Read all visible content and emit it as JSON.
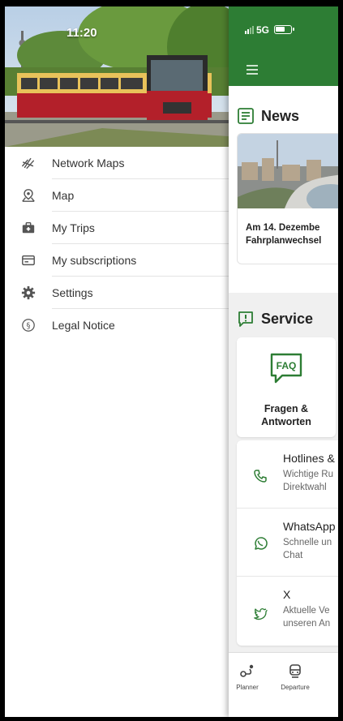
{
  "status": {
    "time": "11:20",
    "network": "5G"
  },
  "drawer": {
    "items": [
      {
        "label": "Network Maps",
        "icon": "network-map-icon"
      },
      {
        "label": "Map",
        "icon": "map-pin-icon"
      },
      {
        "label": "My Trips",
        "icon": "briefcase-icon"
      },
      {
        "label": "My subscriptions",
        "icon": "ticket-card-icon"
      },
      {
        "label": "Settings",
        "icon": "gear-icon"
      },
      {
        "label": "Legal Notice",
        "icon": "paragraph-icon"
      }
    ]
  },
  "news": {
    "title": "News",
    "card_line1": "Am 14. Dezembe",
    "card_line2": "Fahrplanwechsel"
  },
  "service": {
    "title": "Service",
    "faq_badge": "FAQ",
    "faq_line1": "Fragen &",
    "faq_line2": "Antworten",
    "contacts": [
      {
        "title": "Hotlines &",
        "line1": "Wichtige Ru",
        "line2": "Direktwahl",
        "icon": "phone-icon"
      },
      {
        "title": "WhatsApp",
        "line1": "Schnelle un",
        "line2": "Chat",
        "icon": "whatsapp-icon"
      },
      {
        "title": "X",
        "line1": "Aktuelle Ve",
        "line2": "unseren An",
        "icon": "bird-icon"
      }
    ]
  },
  "bottom_nav": {
    "planner": "Planner",
    "departures": "Departure"
  },
  "colors": {
    "brand_green": "#2d7d34",
    "train_red": "#b3202a",
    "train_yellow": "#e8c25a"
  }
}
